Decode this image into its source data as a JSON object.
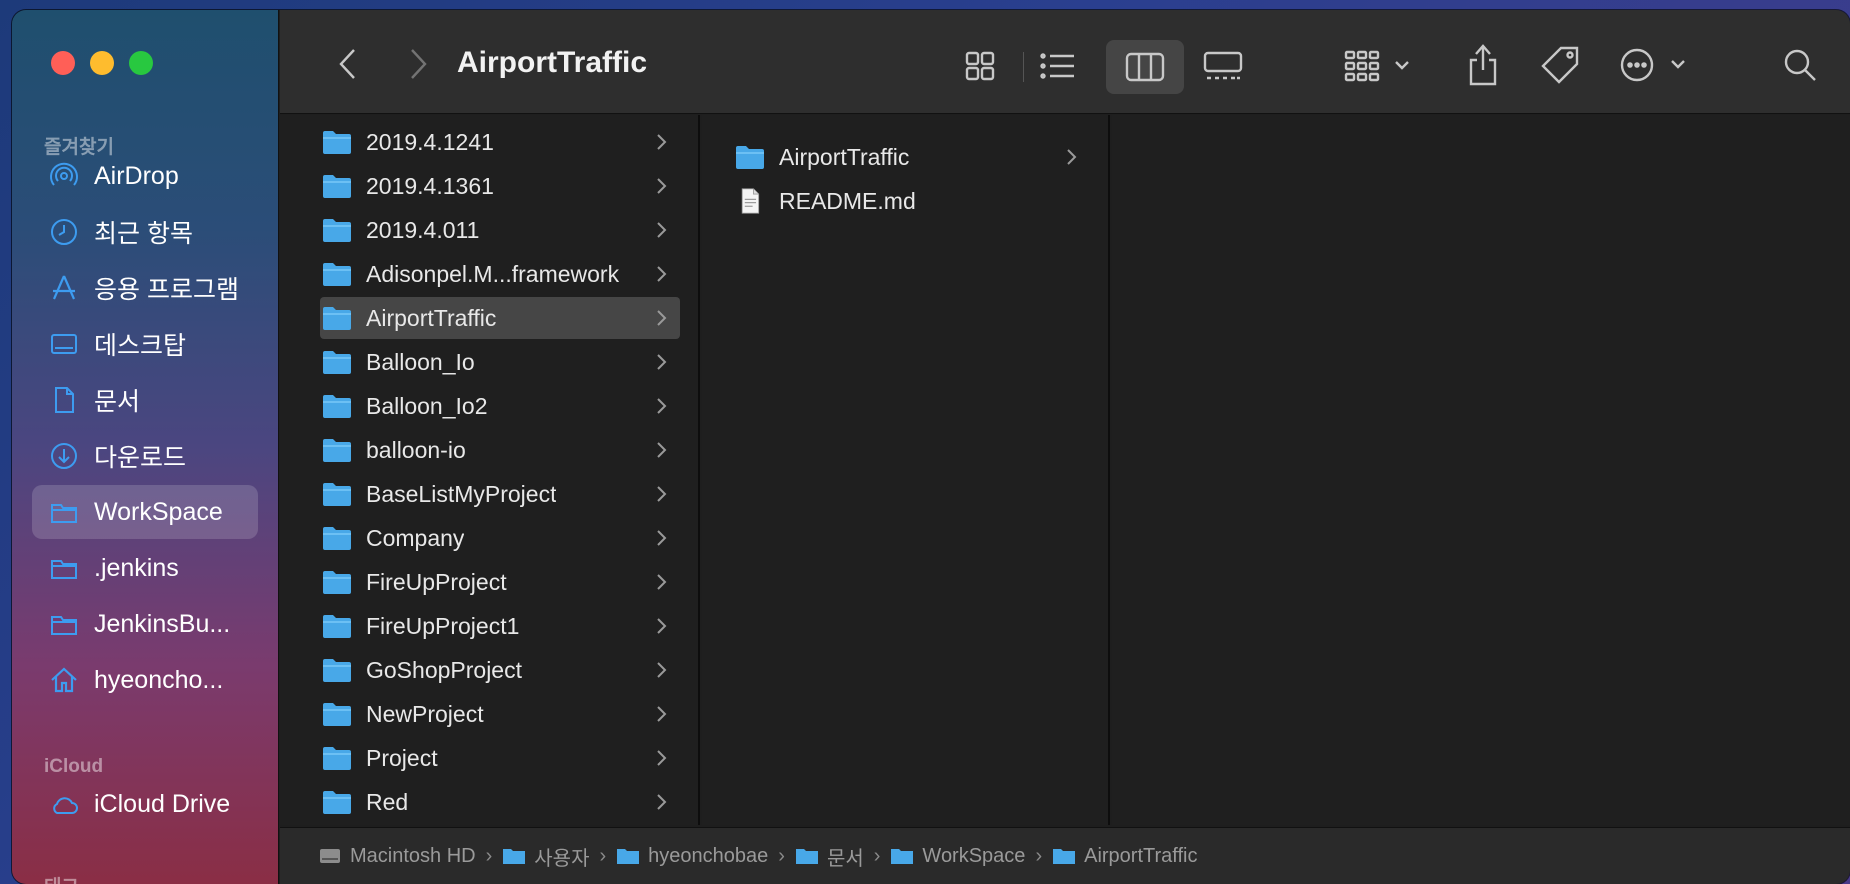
{
  "window": {
    "title": "AirportTraffic"
  },
  "sidebar": {
    "favorites_title": "즐겨찾기",
    "favorites": [
      {
        "label": "AirDrop",
        "icon": "airdrop-icon",
        "selected": false
      },
      {
        "label": "최근 항목",
        "icon": "clock-icon",
        "selected": false
      },
      {
        "label": "응용 프로그램",
        "icon": "apps-icon",
        "selected": false
      },
      {
        "label": "데스크탑",
        "icon": "desktop-icon",
        "selected": false
      },
      {
        "label": "문서",
        "icon": "document-icon",
        "selected": false
      },
      {
        "label": "다운로드",
        "icon": "download-icon",
        "selected": false
      },
      {
        "label": "WorkSpace",
        "icon": "folder-icon",
        "selected": true
      },
      {
        "label": ".jenkins",
        "icon": "folder-icon",
        "selected": false
      },
      {
        "label": "JenkinsBu...",
        "icon": "folder-icon",
        "selected": false
      },
      {
        "label": "hyeoncho...",
        "icon": "home-icon",
        "selected": false
      }
    ],
    "icloud_title": "iCloud",
    "icloud": [
      {
        "label": "iCloud Drive",
        "icon": "cloud-icon",
        "selected": false
      }
    ],
    "tags_title": "태그"
  },
  "toolbar": {
    "back": "back-chevron-icon",
    "forward": "forward-chevron-icon",
    "views": [
      "icon-view-icon",
      "list-view-icon",
      "column-view-icon",
      "gallery-view-icon"
    ],
    "selected_view": "column-view-icon",
    "actions": [
      "group-icon",
      "share-icon",
      "tag-icon",
      "more-icon",
      "search-icon"
    ]
  },
  "column1": {
    "items": [
      {
        "label": "2019.4.1241",
        "selected": false
      },
      {
        "label": "2019.4.1361",
        "selected": false
      },
      {
        "label": "2019.4.011",
        "selected": false
      },
      {
        "label": "Adisonpel.M...framework",
        "selected": false
      },
      {
        "label": "AirportTraffic",
        "selected": true
      },
      {
        "label": "Balloon_Io",
        "selected": false
      },
      {
        "label": "Balloon_Io2",
        "selected": false
      },
      {
        "label": "balloon-io",
        "selected": false
      },
      {
        "label": "BaseListMyProject",
        "selected": false
      },
      {
        "label": "Company",
        "selected": false
      },
      {
        "label": "FireUpProject",
        "selected": false
      },
      {
        "label": "FireUpProject1",
        "selected": false
      },
      {
        "label": "GoShopProject",
        "selected": false
      },
      {
        "label": "NewProject",
        "selected": false
      },
      {
        "label": "Project",
        "selected": false
      },
      {
        "label": "Red",
        "selected": false
      }
    ]
  },
  "column2": {
    "items": [
      {
        "label": "AirportTraffic",
        "type": "folder"
      },
      {
        "label": "README.md",
        "type": "file"
      }
    ]
  },
  "pathbar": {
    "crumbs": [
      "Macintosh HD",
      "사용자",
      "hyeonchobae",
      "문서",
      "WorkSpace",
      "AirportTraffic"
    ]
  },
  "colors": {
    "folder": "#48a8e8",
    "sidebar_icon": "#3d9cf0",
    "selection": "#464646"
  }
}
